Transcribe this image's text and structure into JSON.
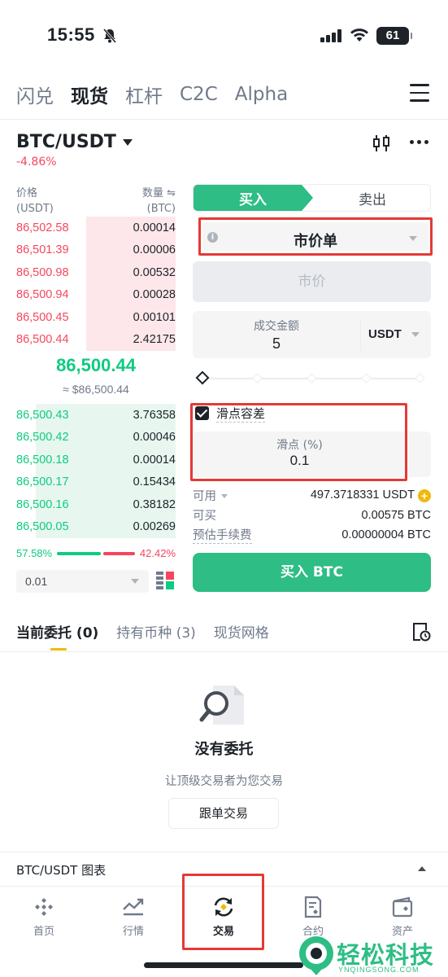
{
  "status_bar": {
    "time": "15:55",
    "battery": "61"
  },
  "top_tabs": [
    {
      "label": "闪兑",
      "active": false
    },
    {
      "label": "现货",
      "active": true
    },
    {
      "label": "杠杆",
      "active": false
    },
    {
      "label": "C2C",
      "active": false
    },
    {
      "label": "Alpha",
      "active": false
    }
  ],
  "pair": {
    "symbol": "BTC/USDT",
    "change": "-4.86%"
  },
  "orderbook": {
    "price_header": "价格",
    "price_unit": "(USDT)",
    "qty_header": "数量 ⇋",
    "qty_unit": "(BTC)",
    "asks": [
      {
        "price": "86,502.58",
        "qty": "0.00014",
        "depth": 0.56
      },
      {
        "price": "86,501.39",
        "qty": "0.00006",
        "depth": 0.56
      },
      {
        "price": "86,500.98",
        "qty": "0.00532",
        "depth": 0.56
      },
      {
        "price": "86,500.94",
        "qty": "0.00028",
        "depth": 0.56
      },
      {
        "price": "86,500.45",
        "qty": "0.00101",
        "depth": 0.56
      },
      {
        "price": "86,500.44",
        "qty": "2.42175",
        "depth": 0.56
      }
    ],
    "mid_price": "86,500.44",
    "mid_usd": "≈ $86,500.44",
    "bids": [
      {
        "price": "86,500.43",
        "qty": "3.76358",
        "depth": 0.88
      },
      {
        "price": "86,500.42",
        "qty": "0.00046",
        "depth": 0.88
      },
      {
        "price": "86,500.18",
        "qty": "0.00014",
        "depth": 0.88
      },
      {
        "price": "86,500.17",
        "qty": "0.15434",
        "depth": 0.88
      },
      {
        "price": "86,500.16",
        "qty": "0.38182",
        "depth": 0.88
      },
      {
        "price": "86,500.05",
        "qty": "0.00269",
        "depth": 0.88
      }
    ],
    "buy_ratio": "57.58%",
    "sell_ratio": "42.42%",
    "buy_ratio_value": 57.58,
    "depth_step": "0.01"
  },
  "trade_form": {
    "buy_label": "买入",
    "sell_label": "卖出",
    "order_type": "市价单",
    "price_placeholder": "市价",
    "amount_label": "成交金额",
    "amount_value": "5",
    "amount_unit": "USDT",
    "slippage_label": "滑点容差",
    "slippage_inner_label": "滑点 (%)",
    "slippage_value": "0.1",
    "available_label": "可用",
    "available_value": "497.3718331 USDT",
    "can_buy_label": "可买",
    "can_buy_value": "0.00575 BTC",
    "fee_label": "预估手续费",
    "fee_value": "0.00000004 BTC",
    "submit_label": "买入 BTC"
  },
  "orders": {
    "tabs": [
      {
        "label": "当前委托 (0)",
        "active": true
      },
      {
        "label": "持有币种 (3)",
        "active": false
      },
      {
        "label": "现货网格",
        "active": false
      }
    ],
    "empty_title": "没有委托",
    "empty_subtitle": "让顶级交易者为您交易",
    "copy_trade_button": "跟单交易"
  },
  "chart_bar": {
    "title": "BTC/USDT 图表"
  },
  "bottom_nav": [
    {
      "label": "首页",
      "icon": "home-diamond-icon",
      "active": false
    },
    {
      "label": "行情",
      "icon": "market-chart-icon",
      "active": false
    },
    {
      "label": "交易",
      "icon": "trade-exchange-icon",
      "active": true
    },
    {
      "label": "合约",
      "icon": "futures-document-icon",
      "active": false
    },
    {
      "label": "资产",
      "icon": "wallet-icon",
      "active": false
    }
  ],
  "watermark": {
    "text": "轻松科技",
    "subtext": "YNQINGSONG.COM"
  },
  "colors": {
    "buy": "#2ebd85",
    "sell": "#f6465d",
    "accent": "#f0b90b",
    "highlight": "#e53935"
  }
}
